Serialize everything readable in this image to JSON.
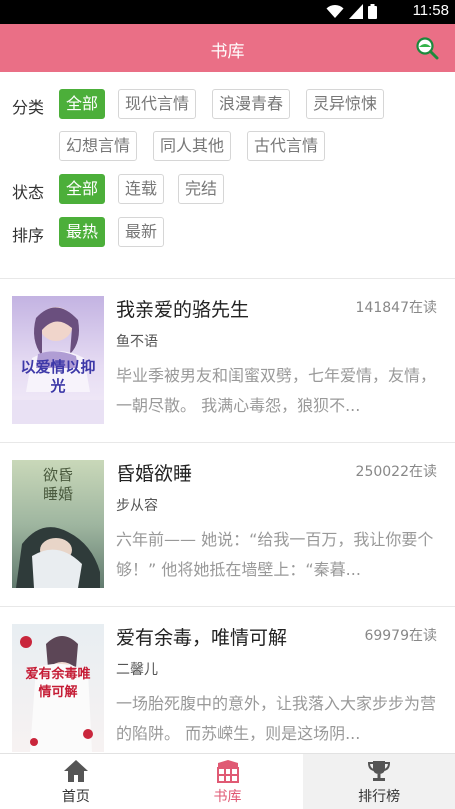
{
  "status_bar": {
    "time": "11:58",
    "icons": [
      "wifi-icon",
      "signal-icon",
      "battery-icon"
    ]
  },
  "header": {
    "title": "书库",
    "search_icon": "search-icon"
  },
  "filters": {
    "category": {
      "label": "分类",
      "options": [
        "全部",
        "现代言情",
        "浪漫青春",
        "灵异惊悚",
        "幻想言情",
        "同人其他",
        "古代言情"
      ],
      "selected": "全部"
    },
    "status": {
      "label": "状态",
      "options": [
        "全部",
        "连载",
        "完结"
      ],
      "selected": "全部"
    },
    "sort": {
      "label": "排序",
      "options": [
        "最热",
        "最新"
      ],
      "selected": "最热"
    }
  },
  "books": [
    {
      "title": "我亲爱的骆先生",
      "readers": "141847在读",
      "author": "鱼不语",
      "description": "毕业季被男友和闺蜜双劈，七年爱情，友情，一朝尽散。 我满心毒怨，狼狈不...",
      "cover_text": "以爱情以抑光"
    },
    {
      "title": "昏婚欲睡",
      "readers": "250022在读",
      "author": "步从容",
      "description": "六年前—— 她说：“给我一百万，我让你要个够！” 他将她抵在墙壁上：“秦暮...",
      "cover_text": "欲昏睡婚"
    },
    {
      "title": "爱有余毒，唯情可解",
      "readers": "69979在读",
      "author": "二馨儿",
      "description": "一场胎死腹中的意外，让我落入大家步步为营的陷阱。 而苏嵘生，则是这场阴...",
      "cover_text": "爱有余毒唯情可解"
    }
  ],
  "bottom_nav": [
    {
      "label": "首页",
      "icon": "home-icon",
      "active": false
    },
    {
      "label": "书库",
      "icon": "bookshelf-icon",
      "active": true
    },
    {
      "label": "排行榜",
      "icon": "trophy-icon",
      "active": false
    }
  ],
  "colors": {
    "header": "#ea6f86",
    "tag_active": "#4caf3a",
    "nav_active": "#e05a74"
  }
}
